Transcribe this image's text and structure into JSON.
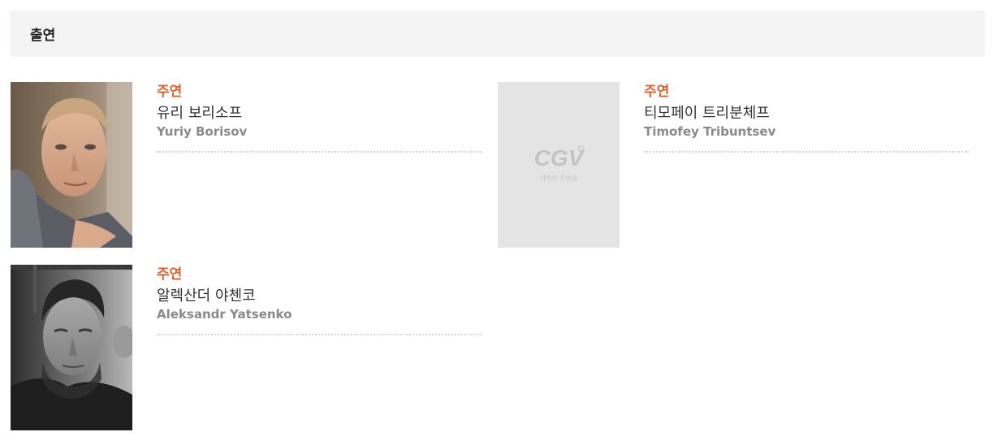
{
  "section": {
    "title": "출연"
  },
  "cast": [
    {
      "role": "주연",
      "name_ko": "유리 보리소프",
      "name_en": "Yuriy Borisov",
      "photo": "portrait-photo"
    },
    {
      "role": "주연",
      "name_ko": "티모페이 트리분체프",
      "name_en": "Timofey Tribuntsev",
      "photo": "placeholder"
    },
    {
      "role": "주연",
      "name_ko": "알렉산더 야첸코",
      "name_en": "Aleksandr Yatsenko",
      "photo": "portrait-photo-bw"
    }
  ],
  "placeholder": {
    "logo": "CGV",
    "caption": "이미지 준비중"
  },
  "colors": {
    "role": "#e0602a",
    "header_bg": "#f4f4f4",
    "placeholder_bg": "#e4e4e4"
  }
}
